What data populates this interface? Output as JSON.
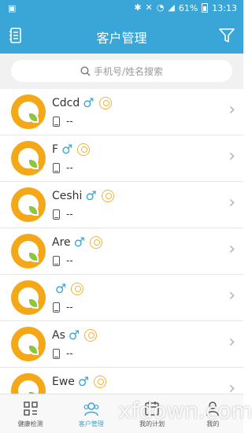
{
  "status_bar": {
    "battery": "61%",
    "time": "13:13"
  },
  "header": {
    "title": "客户管理"
  },
  "search": {
    "placeholder": "手机号/姓名搜索"
  },
  "customers": [
    {
      "name": "Cdcd",
      "phone": "--"
    },
    {
      "name": "F",
      "phone": "--"
    },
    {
      "name": "Ceshi",
      "phone": "--"
    },
    {
      "name": "Are",
      "phone": "--"
    },
    {
      "name": "",
      "phone": "--"
    },
    {
      "name": "As",
      "phone": "--"
    },
    {
      "name": "Ewe",
      "phone": "--"
    }
  ],
  "tabs": [
    {
      "label": "健康检测",
      "icon": "grid-icon"
    },
    {
      "label": "客户管理",
      "icon": "users-icon",
      "active": true
    },
    {
      "label": "我的计划",
      "icon": "calendar-icon"
    },
    {
      "label": "我的",
      "icon": "person-icon"
    }
  ],
  "watermark": "xfdown.com",
  "colors": {
    "primary": "#3aa6d8",
    "avatar": "#f4a817",
    "leaf": "#8cc63f",
    "badge": "#f0b43c"
  }
}
